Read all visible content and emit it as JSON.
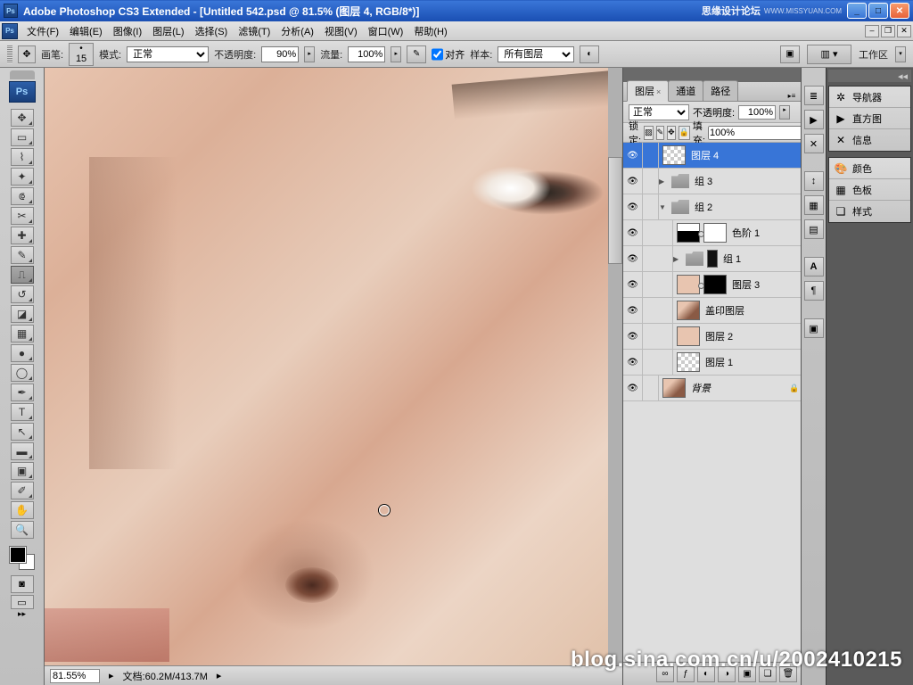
{
  "title": "Adobe Photoshop CS3 Extended - [Untitled 542.psd @ 81.5% (图层 4, RGB/8*)]",
  "watermark_top": "思缘设计论坛",
  "watermark_top2": "WWW.MISSYUAN.COM",
  "menu": [
    "文件(F)",
    "编辑(E)",
    "图像(I)",
    "图层(L)",
    "选择(S)",
    "滤镜(T)",
    "分析(A)",
    "视图(V)",
    "窗口(W)",
    "帮助(H)"
  ],
  "opt": {
    "brush_label": "画笔:",
    "brush_size": "15",
    "mode_label": "模式:",
    "mode_value": "正常",
    "opacity_label": "不透明度:",
    "opacity_value": "90%",
    "flow_label": "流量:",
    "flow_value": "100%",
    "align_label": "对齐",
    "sample_label": "样本:",
    "sample_value": "所有图层",
    "workspace_label": "工作区"
  },
  "layers_panel": {
    "tabs": [
      "图层",
      "通道",
      "路径"
    ],
    "blend": "正常",
    "opacity_label": "不透明度:",
    "opacity_value": "100%",
    "lock_label": "锁定:",
    "fill_label": "填充:",
    "fill_value": "100%",
    "items": [
      {
        "name": "图层 4",
        "sel": true,
        "thumb": "trans"
      },
      {
        "name": "组 3",
        "folder": true,
        "disc": "▶"
      },
      {
        "name": "组 2",
        "folder": true,
        "disc": "▼"
      },
      {
        "name": "色阶 1",
        "indent": 1,
        "thumb": "hist",
        "mask": "white"
      },
      {
        "name": "组 1",
        "indent": 1,
        "folder": true,
        "disc": "▶",
        "extra": true
      },
      {
        "name": "图层 3",
        "indent": 1,
        "thumb": "skin",
        "mask": "dark"
      },
      {
        "name": "盖印图层",
        "indent": 1,
        "thumb": "face"
      },
      {
        "name": "图层 2",
        "indent": 1,
        "thumb": "skin"
      },
      {
        "name": "图层 1",
        "indent": 1,
        "thumb": "trans"
      },
      {
        "name": "背景",
        "thumb": "face",
        "locked": true,
        "italic": true
      }
    ]
  },
  "palettes": [
    [
      {
        "icon": "✲",
        "label": "导航器"
      },
      {
        "icon": "▶",
        "label": "直方图"
      },
      {
        "icon": "✕",
        "label": "信息"
      }
    ],
    [
      {
        "icon": "🎨",
        "label": "颜色"
      },
      {
        "icon": "▦",
        "label": "色板"
      },
      {
        "icon": "❏",
        "label": "样式"
      }
    ]
  ],
  "status": {
    "zoom": "81.55%",
    "doc_label": "文档:",
    "doc_value": "60.2M/413.7M"
  },
  "watermark_foot": "blog.sina.com.cn/u/2002410215"
}
